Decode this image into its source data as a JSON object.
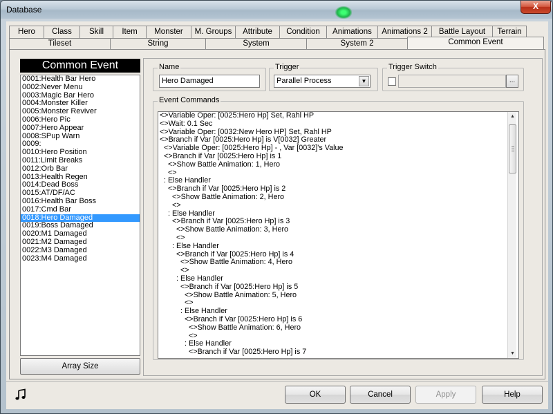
{
  "window": {
    "title": "Database",
    "close_symbol": "X"
  },
  "tabs_row1": [
    "Hero",
    "Class",
    "Skill",
    "Item",
    "Monster",
    "M. Groups",
    "Attribute",
    "Condition",
    "Animations",
    "Animations 2",
    "Battle Layout",
    "Terrain"
  ],
  "tabs_row2": [
    "Tileset",
    "String",
    "System",
    "System 2",
    "Common Event"
  ],
  "active_tab": "Common Event",
  "common_event": {
    "header": "Common Event",
    "items": [
      "0001:Health Bar Hero",
      "0002:Never Menu",
      "0003:Magic Bar Hero",
      "0004:Monster Killer",
      "0005:Monster Reviver",
      "0006:Hero Pic",
      "0007:Hero Appear",
      "0008:SPup Warn",
      "0009:",
      "0010:Hero Position",
      "0011:Limit Breaks",
      "0012:Orb Bar",
      "0013:Health Regen",
      "0014:Dead Boss",
      "0015:AT/DF/AC",
      "0016:Health Bar Boss",
      "0017:Cmd Bar",
      "0018:Hero Damaged",
      "0019:Boss Damaged",
      "0020:M1 Damaged",
      "0021:M2 Damaged",
      "0022:M3 Damaged",
      "0023:M4 Damaged"
    ],
    "selected_index": 17,
    "array_size_label": "Array Size"
  },
  "name": {
    "label": "Name",
    "value": "Hero Damaged"
  },
  "trigger": {
    "label": "Trigger",
    "value": "Parallel Process"
  },
  "trigger_switch": {
    "label": "Trigger Switch",
    "button": "..."
  },
  "event_commands": {
    "label": "Event Commands",
    "lines": [
      "<>Variable Oper: [0025:Hero Hp] Set, Rahl HP",
      "<>Wait: 0.1 Sec",
      "<>Variable Oper: [0032:New Hero HP] Set, Rahl HP",
      "<>Branch if Var [0025:Hero Hp] is V[0032] Greater",
      "  <>Variable Oper: [0025:Hero Hp] - , Var [0032]'s Value",
      "  <>Branch if Var [0025:Hero Hp] is 1",
      "    <>Show Battle Animation: 1, Hero",
      "    <>",
      "  : Else Handler",
      "    <>Branch if Var [0025:Hero Hp] is 2",
      "      <>Show Battle Animation: 2, Hero",
      "      <>",
      "    : Else Handler",
      "      <>Branch if Var [0025:Hero Hp] is 3",
      "        <>Show Battle Animation: 3, Hero",
      "        <>",
      "      : Else Handler",
      "        <>Branch if Var [0025:Hero Hp] is 4",
      "          <>Show Battle Animation: 4, Hero",
      "          <>",
      "        : Else Handler",
      "          <>Branch if Var [0025:Hero Hp] is 5",
      "            <>Show Battle Animation: 5, Hero",
      "            <>",
      "          : Else Handler",
      "            <>Branch if Var [0025:Hero Hp] is 6",
      "              <>Show Battle Animation: 6, Hero",
      "              <>",
      "            : Else Handler",
      "              <>Branch if Var [0025:Hero Hp] is 7"
    ]
  },
  "footer": {
    "ok": "OK",
    "cancel": "Cancel",
    "apply": "Apply",
    "help": "Help",
    "music_icon": "music-note-icon"
  }
}
